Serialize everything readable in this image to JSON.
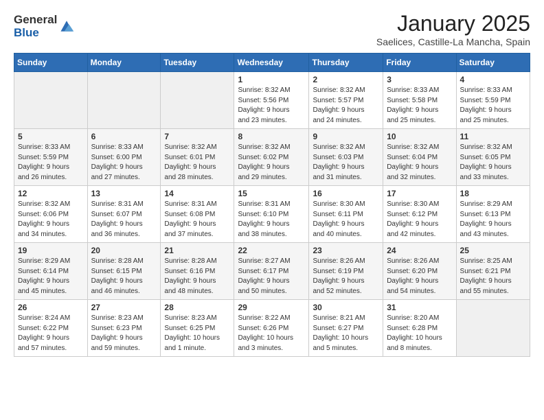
{
  "header": {
    "logo": {
      "general": "General",
      "blue": "Blue"
    },
    "title": "January 2025",
    "subtitle": "Saelices, Castille-La Mancha, Spain"
  },
  "weekdays": [
    "Sunday",
    "Monday",
    "Tuesday",
    "Wednesday",
    "Thursday",
    "Friday",
    "Saturday"
  ],
  "weeks": [
    [
      {
        "day": "",
        "info": ""
      },
      {
        "day": "",
        "info": ""
      },
      {
        "day": "",
        "info": ""
      },
      {
        "day": "1",
        "info": "Sunrise: 8:32 AM\nSunset: 5:56 PM\nDaylight: 9 hours\nand 23 minutes."
      },
      {
        "day": "2",
        "info": "Sunrise: 8:32 AM\nSunset: 5:57 PM\nDaylight: 9 hours\nand 24 minutes."
      },
      {
        "day": "3",
        "info": "Sunrise: 8:33 AM\nSunset: 5:58 PM\nDaylight: 9 hours\nand 25 minutes."
      },
      {
        "day": "4",
        "info": "Sunrise: 8:33 AM\nSunset: 5:59 PM\nDaylight: 9 hours\nand 25 minutes."
      }
    ],
    [
      {
        "day": "5",
        "info": "Sunrise: 8:33 AM\nSunset: 5:59 PM\nDaylight: 9 hours\nand 26 minutes."
      },
      {
        "day": "6",
        "info": "Sunrise: 8:33 AM\nSunset: 6:00 PM\nDaylight: 9 hours\nand 27 minutes."
      },
      {
        "day": "7",
        "info": "Sunrise: 8:32 AM\nSunset: 6:01 PM\nDaylight: 9 hours\nand 28 minutes."
      },
      {
        "day": "8",
        "info": "Sunrise: 8:32 AM\nSunset: 6:02 PM\nDaylight: 9 hours\nand 29 minutes."
      },
      {
        "day": "9",
        "info": "Sunrise: 8:32 AM\nSunset: 6:03 PM\nDaylight: 9 hours\nand 31 minutes."
      },
      {
        "day": "10",
        "info": "Sunrise: 8:32 AM\nSunset: 6:04 PM\nDaylight: 9 hours\nand 32 minutes."
      },
      {
        "day": "11",
        "info": "Sunrise: 8:32 AM\nSunset: 6:05 PM\nDaylight: 9 hours\nand 33 minutes."
      }
    ],
    [
      {
        "day": "12",
        "info": "Sunrise: 8:32 AM\nSunset: 6:06 PM\nDaylight: 9 hours\nand 34 minutes."
      },
      {
        "day": "13",
        "info": "Sunrise: 8:31 AM\nSunset: 6:07 PM\nDaylight: 9 hours\nand 36 minutes."
      },
      {
        "day": "14",
        "info": "Sunrise: 8:31 AM\nSunset: 6:08 PM\nDaylight: 9 hours\nand 37 minutes."
      },
      {
        "day": "15",
        "info": "Sunrise: 8:31 AM\nSunset: 6:10 PM\nDaylight: 9 hours\nand 38 minutes."
      },
      {
        "day": "16",
        "info": "Sunrise: 8:30 AM\nSunset: 6:11 PM\nDaylight: 9 hours\nand 40 minutes."
      },
      {
        "day": "17",
        "info": "Sunrise: 8:30 AM\nSunset: 6:12 PM\nDaylight: 9 hours\nand 42 minutes."
      },
      {
        "day": "18",
        "info": "Sunrise: 8:29 AM\nSunset: 6:13 PM\nDaylight: 9 hours\nand 43 minutes."
      }
    ],
    [
      {
        "day": "19",
        "info": "Sunrise: 8:29 AM\nSunset: 6:14 PM\nDaylight: 9 hours\nand 45 minutes."
      },
      {
        "day": "20",
        "info": "Sunrise: 8:28 AM\nSunset: 6:15 PM\nDaylight: 9 hours\nand 46 minutes."
      },
      {
        "day": "21",
        "info": "Sunrise: 8:28 AM\nSunset: 6:16 PM\nDaylight: 9 hours\nand 48 minutes."
      },
      {
        "day": "22",
        "info": "Sunrise: 8:27 AM\nSunset: 6:17 PM\nDaylight: 9 hours\nand 50 minutes."
      },
      {
        "day": "23",
        "info": "Sunrise: 8:26 AM\nSunset: 6:19 PM\nDaylight: 9 hours\nand 52 minutes."
      },
      {
        "day": "24",
        "info": "Sunrise: 8:26 AM\nSunset: 6:20 PM\nDaylight: 9 hours\nand 54 minutes."
      },
      {
        "day": "25",
        "info": "Sunrise: 8:25 AM\nSunset: 6:21 PM\nDaylight: 9 hours\nand 55 minutes."
      }
    ],
    [
      {
        "day": "26",
        "info": "Sunrise: 8:24 AM\nSunset: 6:22 PM\nDaylight: 9 hours\nand 57 minutes."
      },
      {
        "day": "27",
        "info": "Sunrise: 8:23 AM\nSunset: 6:23 PM\nDaylight: 9 hours\nand 59 minutes."
      },
      {
        "day": "28",
        "info": "Sunrise: 8:23 AM\nSunset: 6:25 PM\nDaylight: 10 hours\nand 1 minute."
      },
      {
        "day": "29",
        "info": "Sunrise: 8:22 AM\nSunset: 6:26 PM\nDaylight: 10 hours\nand 3 minutes."
      },
      {
        "day": "30",
        "info": "Sunrise: 8:21 AM\nSunset: 6:27 PM\nDaylight: 10 hours\nand 5 minutes."
      },
      {
        "day": "31",
        "info": "Sunrise: 8:20 AM\nSunset: 6:28 PM\nDaylight: 10 hours\nand 8 minutes."
      },
      {
        "day": "",
        "info": ""
      }
    ]
  ]
}
